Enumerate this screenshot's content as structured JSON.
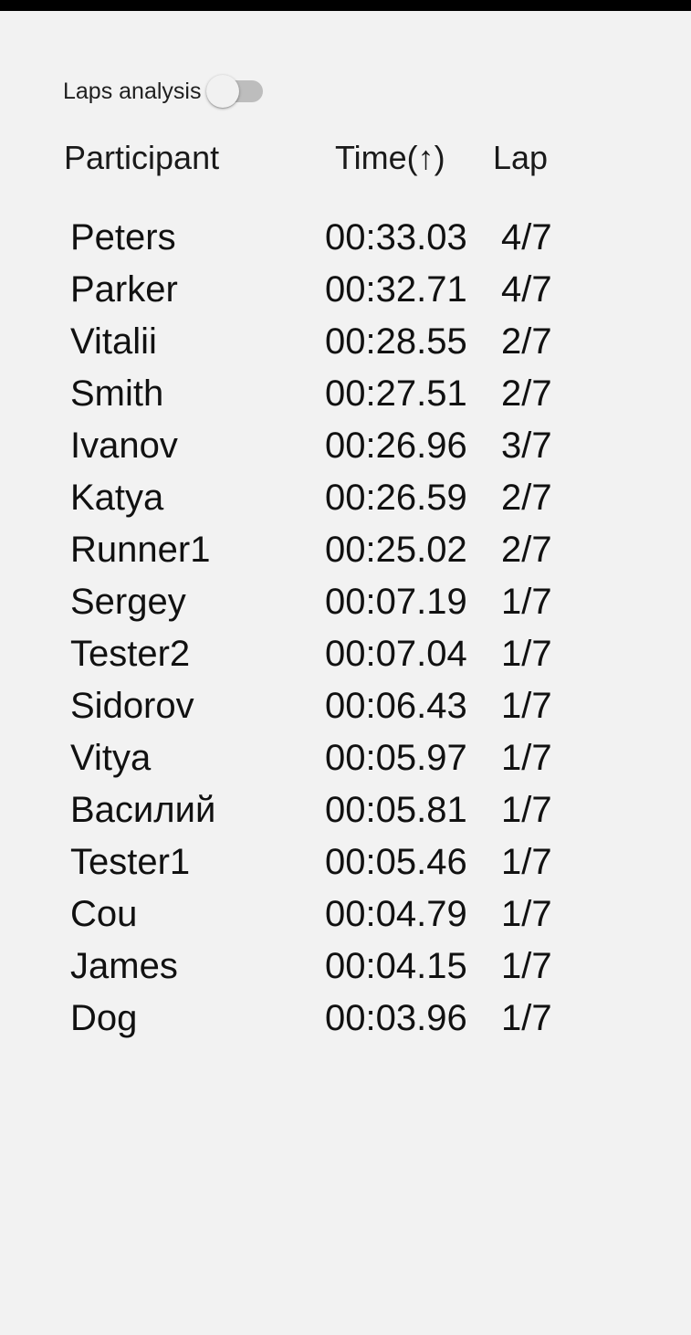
{
  "laps_toggle": {
    "label": "Laps analysis",
    "enabled": false
  },
  "table": {
    "headers": {
      "participant": "Participant",
      "time": "Time(↑)",
      "lap": "Lap"
    },
    "rows": [
      {
        "participant": "Peters",
        "time": "00:33.03",
        "lap": "4/7"
      },
      {
        "participant": "Parker",
        "time": "00:32.71",
        "lap": "4/7"
      },
      {
        "participant": "Vitalii",
        "time": "00:28.55",
        "lap": "2/7"
      },
      {
        "participant": "Smith",
        "time": "00:27.51",
        "lap": "2/7"
      },
      {
        "participant": "Ivanov",
        "time": "00:26.96",
        "lap": "3/7"
      },
      {
        "participant": "Katya",
        "time": "00:26.59",
        "lap": "2/7"
      },
      {
        "participant": "Runner1",
        "time": "00:25.02",
        "lap": "2/7"
      },
      {
        "participant": "Sergey",
        "time": "00:07.19",
        "lap": "1/7"
      },
      {
        "participant": "Tester2",
        "time": "00:07.04",
        "lap": "1/7"
      },
      {
        "participant": "Sidorov",
        "time": "00:06.43",
        "lap": "1/7"
      },
      {
        "participant": "Vitya",
        "time": "00:05.97",
        "lap": "1/7"
      },
      {
        "participant": "Василий",
        "time": "00:05.81",
        "lap": "1/7"
      },
      {
        "participant": "Tester1",
        "time": "00:05.46",
        "lap": "1/7"
      },
      {
        "participant": "Cou",
        "time": "00:04.79",
        "lap": "1/7"
      },
      {
        "participant": "James",
        "time": "00:04.15",
        "lap": "1/7"
      },
      {
        "participant": "Dog",
        "time": "00:03.96",
        "lap": "1/7"
      }
    ]
  }
}
